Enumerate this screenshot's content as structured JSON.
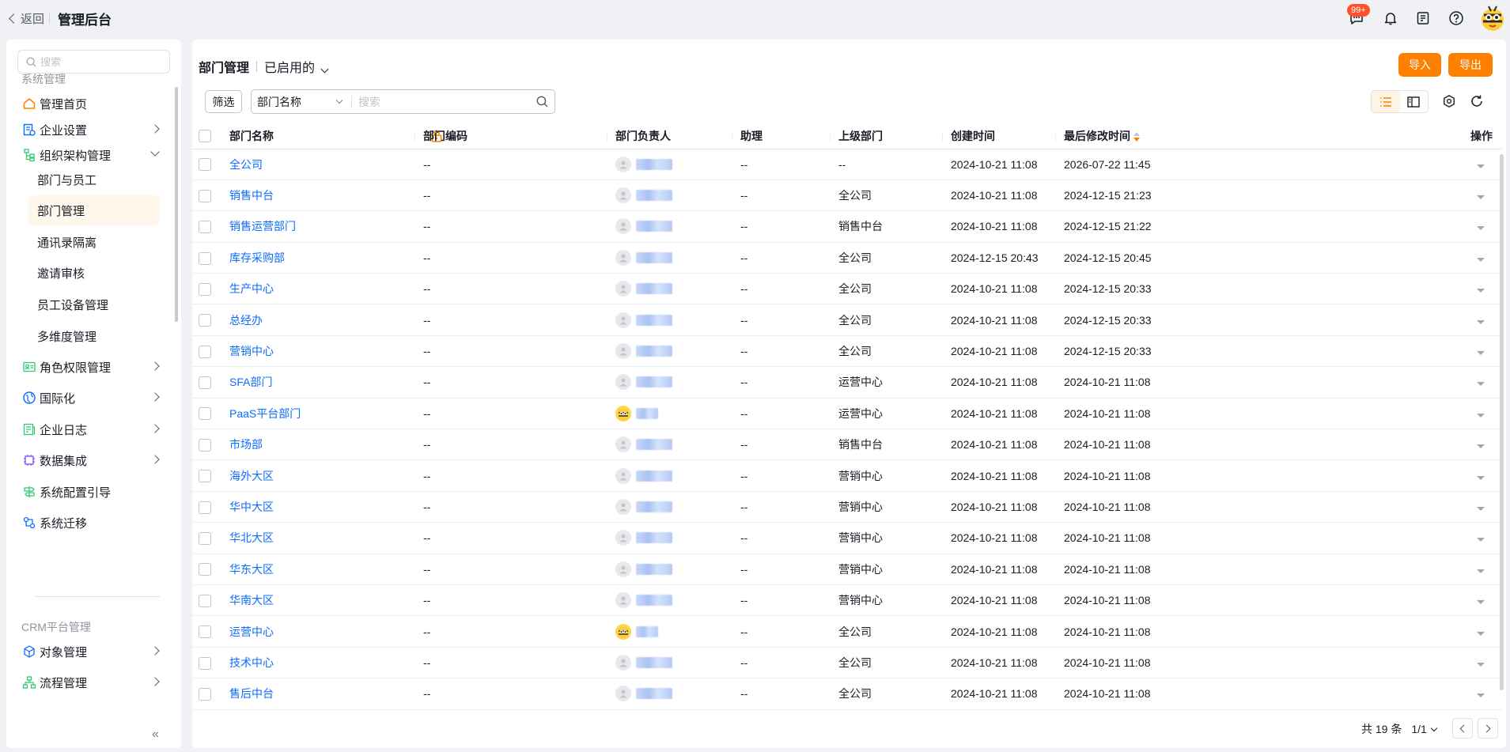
{
  "topbar": {
    "back_label": "返回",
    "title": "管理后台",
    "badge": "99+",
    "icons": [
      "message-icon",
      "bell-icon",
      "notes-icon",
      "help-icon",
      "user-avatar"
    ]
  },
  "sidebar": {
    "search_placeholder": "搜索",
    "group1": "系统管理",
    "items": [
      {
        "label": "管理首页",
        "icon": "home-icon"
      },
      {
        "label": "企业设置",
        "icon": "enterprise-icon"
      },
      {
        "label": "组织架构管理",
        "icon": "org-icon"
      },
      {
        "label": "角色权限管理",
        "icon": "role-icon"
      },
      {
        "label": "国际化",
        "icon": "globe-icon"
      },
      {
        "label": "企业日志",
        "icon": "log-icon"
      },
      {
        "label": "数据集成",
        "icon": "chip-icon"
      },
      {
        "label": "系统配置引导",
        "icon": "signpost-icon"
      },
      {
        "label": "系统迁移",
        "icon": "migrate-icon"
      }
    ],
    "sub_items": [
      "部门与员工",
      "部门管理",
      "通讯录隔离",
      "邀请审核",
      "员工设备管理",
      "多维度管理"
    ],
    "group2": "CRM平台管理",
    "crm_items": [
      {
        "label": "对象管理",
        "icon": "object-icon"
      },
      {
        "label": "流程管理",
        "icon": "flow-icon"
      }
    ],
    "collapse": "«"
  },
  "main": {
    "title": "部门管理",
    "view_label": "已启用的",
    "import_label": "导入",
    "export_label": "导出",
    "filter_label": "筛选",
    "search_field": "部门名称",
    "search_placeholder": "搜索",
    "columns": [
      "部门名称",
      "部门编码",
      "部门负责人",
      "助理",
      "上级部门",
      "创建时间",
      "最后修改时间",
      "操作"
    ],
    "rows": [
      {
        "name": "全公司",
        "code": "--",
        "avatar": "gray",
        "assistant": "--",
        "parent": "--",
        "created": "2024-10-21 11:08",
        "modified": "2026-07-22 11:45"
      },
      {
        "name": "销售中台",
        "code": "--",
        "avatar": "gray",
        "assistant": "--",
        "parent": "全公司",
        "created": "2024-10-21 11:08",
        "modified": "2024-12-15 21:23"
      },
      {
        "name": "销售运营部门",
        "code": "--",
        "avatar": "gray",
        "assistant": "--",
        "parent": "销售中台",
        "created": "2024-10-21 11:08",
        "modified": "2024-12-15 21:22"
      },
      {
        "name": "库存采购部",
        "code": "--",
        "avatar": "gray",
        "assistant": "--",
        "parent": "全公司",
        "created": "2024-12-15 20:43",
        "modified": "2024-12-15 20:45"
      },
      {
        "name": "生产中心",
        "code": "--",
        "avatar": "gray",
        "assistant": "--",
        "parent": "全公司",
        "created": "2024-10-21 11:08",
        "modified": "2024-12-15 20:33"
      },
      {
        "name": "总经办",
        "code": "--",
        "avatar": "gray",
        "assistant": "--",
        "parent": "全公司",
        "created": "2024-10-21 11:08",
        "modified": "2024-12-15 20:33"
      },
      {
        "name": "营销中心",
        "code": "--",
        "avatar": "gray",
        "assistant": "--",
        "parent": "全公司",
        "created": "2024-10-21 11:08",
        "modified": "2024-12-15 20:33"
      },
      {
        "name": "SFA部门",
        "code": "--",
        "avatar": "gray",
        "assistant": "--",
        "parent": "运营中心",
        "created": "2024-10-21 11:08",
        "modified": "2024-10-21 11:08"
      },
      {
        "name": "PaaS平台部门",
        "code": "--",
        "avatar": "bee",
        "assistant": "--",
        "parent": "运营中心",
        "created": "2024-10-21 11:08",
        "modified": "2024-10-21 11:08"
      },
      {
        "name": "市场部",
        "code": "--",
        "avatar": "gray",
        "assistant": "--",
        "parent": "销售中台",
        "created": "2024-10-21 11:08",
        "modified": "2024-10-21 11:08"
      },
      {
        "name": "海外大区",
        "code": "--",
        "avatar": "gray",
        "assistant": "--",
        "parent": "营销中心",
        "created": "2024-10-21 11:08",
        "modified": "2024-10-21 11:08"
      },
      {
        "name": "华中大区",
        "code": "--",
        "avatar": "gray",
        "assistant": "--",
        "parent": "营销中心",
        "created": "2024-10-21 11:08",
        "modified": "2024-10-21 11:08"
      },
      {
        "name": "华北大区",
        "code": "--",
        "avatar": "gray",
        "assistant": "--",
        "parent": "营销中心",
        "created": "2024-10-21 11:08",
        "modified": "2024-10-21 11:08"
      },
      {
        "name": "华东大区",
        "code": "--",
        "avatar": "gray",
        "assistant": "--",
        "parent": "营销中心",
        "created": "2024-10-21 11:08",
        "modified": "2024-10-21 11:08"
      },
      {
        "name": "华南大区",
        "code": "--",
        "avatar": "gray",
        "assistant": "--",
        "parent": "营销中心",
        "created": "2024-10-21 11:08",
        "modified": "2024-10-21 11:08"
      },
      {
        "name": "运营中心",
        "code": "--",
        "avatar": "bee",
        "assistant": "--",
        "parent": "全公司",
        "created": "2024-10-21 11:08",
        "modified": "2024-10-21 11:08"
      },
      {
        "name": "技术中心",
        "code": "--",
        "avatar": "gray",
        "assistant": "--",
        "parent": "全公司",
        "created": "2024-10-21 11:08",
        "modified": "2024-10-21 11:08"
      },
      {
        "name": "售后中台",
        "code": "--",
        "avatar": "gray",
        "assistant": "--",
        "parent": "全公司",
        "created": "2024-10-21 11:08",
        "modified": "2024-10-21 11:08"
      }
    ],
    "total": "共 19 条",
    "page": "1/1"
  },
  "colors": {
    "accent": "#ff8000",
    "link": "#0c6cff"
  }
}
